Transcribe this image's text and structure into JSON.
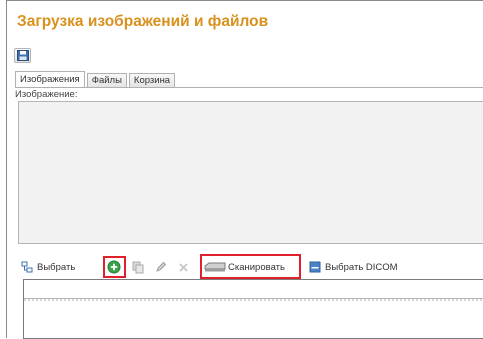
{
  "window": {
    "title": "Загрузка изображений и файлов"
  },
  "toolbar_top": {
    "save_icon": "floppy-disk-icon"
  },
  "tabs": [
    {
      "label": "Изображения",
      "active": true
    },
    {
      "label": "Файлы",
      "active": false
    },
    {
      "label": "Корзина",
      "active": false
    }
  ],
  "image_section": {
    "label": "Изображение:"
  },
  "actions": {
    "select_label": "Выбрать",
    "scan_label": "Сканировать",
    "select_dicom_label": "Выбрать DICOM",
    "icons": [
      "select-icon",
      "add-icon",
      "copy-icon",
      "edit-icon",
      "delete-icon",
      "scanner-icon",
      "dicom-icon"
    ]
  },
  "colors": {
    "title": "#d9911d",
    "highlight": "#e0202a",
    "add": "#3aa44a"
  }
}
